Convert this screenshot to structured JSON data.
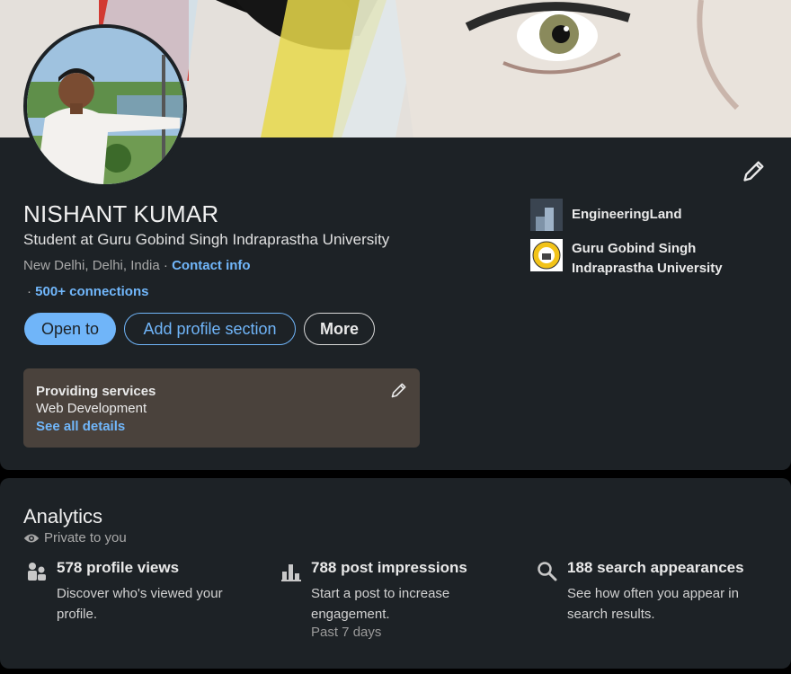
{
  "profile": {
    "name": "NISHANT KUMAR",
    "headline": "Student at Guru Gobind Singh Indraprastha University",
    "location": "New Delhi, Delhi, India",
    "separator": " · ",
    "contact_info": "Contact info",
    "connections_prefix": "· ",
    "connections": "500+ connections"
  },
  "actions": {
    "open_to": "Open to",
    "add_section": "Add profile section",
    "more": "More"
  },
  "services": {
    "title": "Providing services",
    "value": "Web Development",
    "link": "See all details"
  },
  "organizations": [
    {
      "name": "EngineeringLand",
      "icon": "company-logo"
    },
    {
      "name": "Guru Gobind Singh Indraprastha University",
      "icon": "university-logo"
    }
  ],
  "analytics": {
    "title": "Analytics",
    "privacy": "Private to you",
    "stats": [
      {
        "icon": "people-icon",
        "title": "578 profile views",
        "description": "Discover who's viewed your profile."
      },
      {
        "icon": "bar-chart-icon",
        "title": "788 post impressions",
        "description": "Start a post to increase engagement.",
        "sub": "Past 7 days"
      },
      {
        "icon": "search-icon",
        "title": "188 search appearances",
        "description": "See how often you appear in search results."
      }
    ]
  },
  "colors": {
    "card_bg": "#1d2226",
    "accent": "#70b5f9",
    "services_bg": "#4a423c"
  }
}
